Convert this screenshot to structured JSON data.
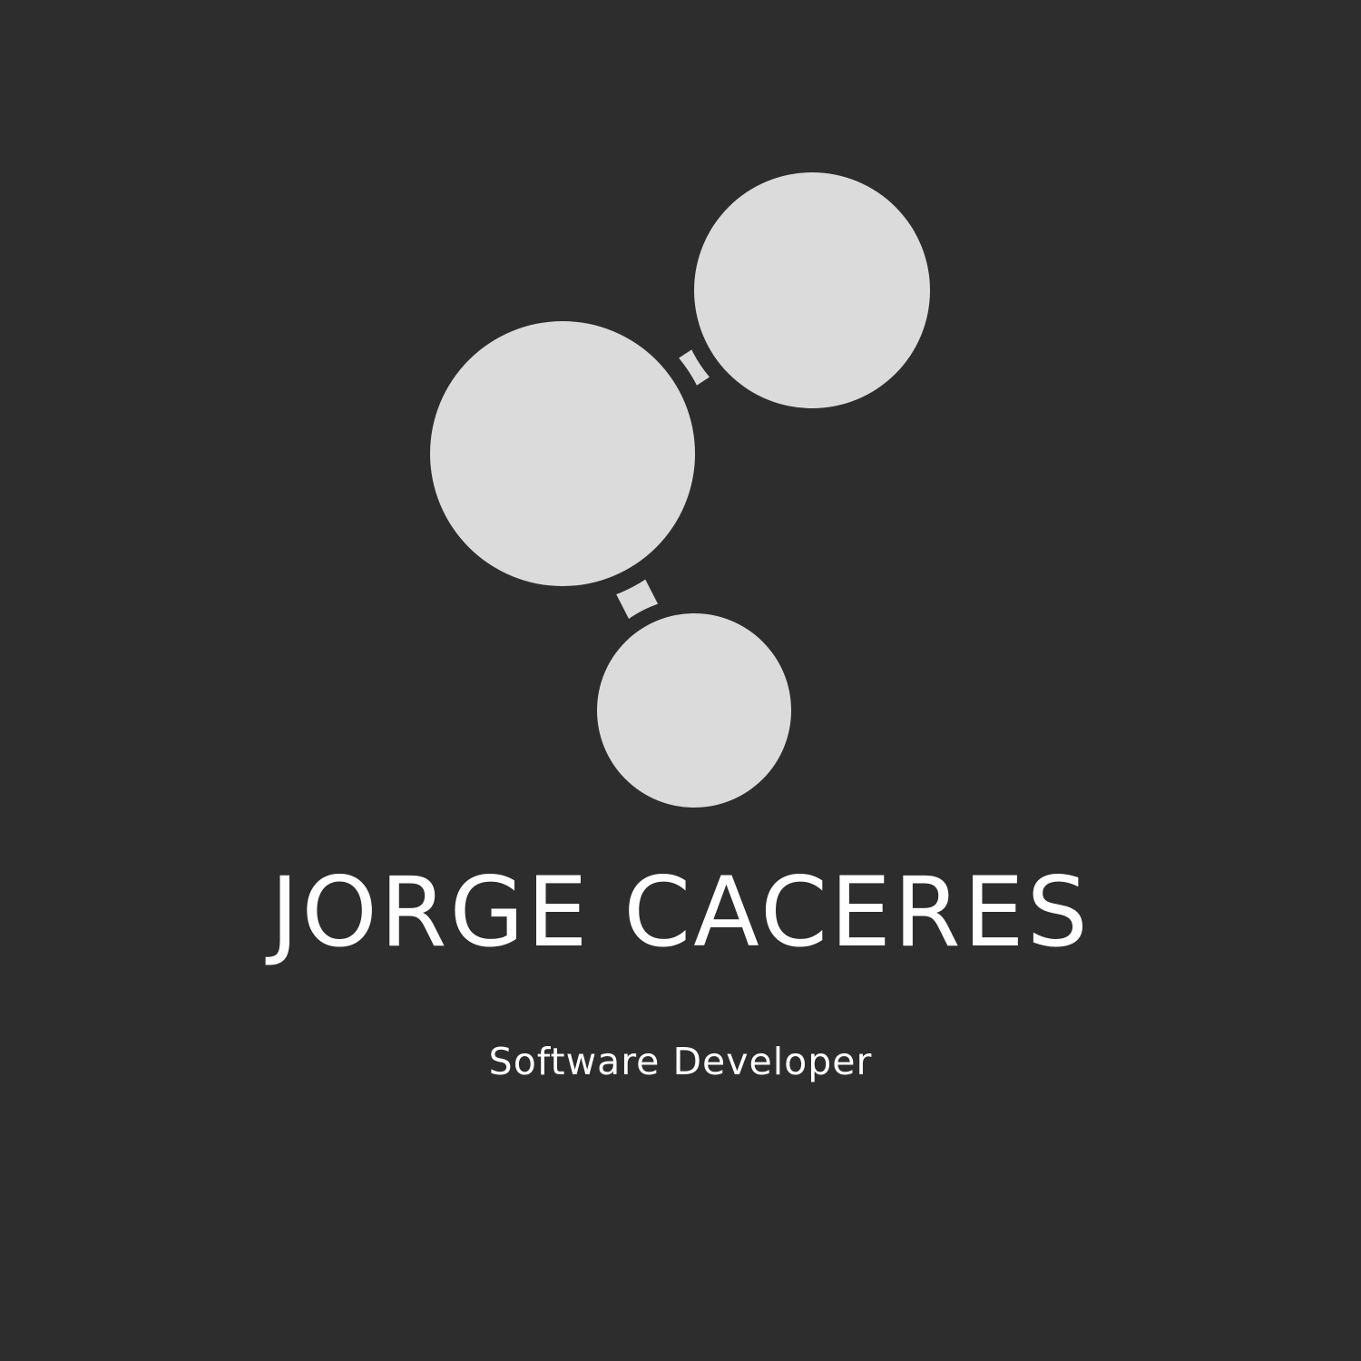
{
  "logo": {
    "icon": "molecule-network-icon",
    "name": "JORGE CACERES",
    "tagline": "Software Developer"
  },
  "colors": {
    "background": "#2d2d2d",
    "icon": "#dbdbdb",
    "text": "#ffffff"
  }
}
